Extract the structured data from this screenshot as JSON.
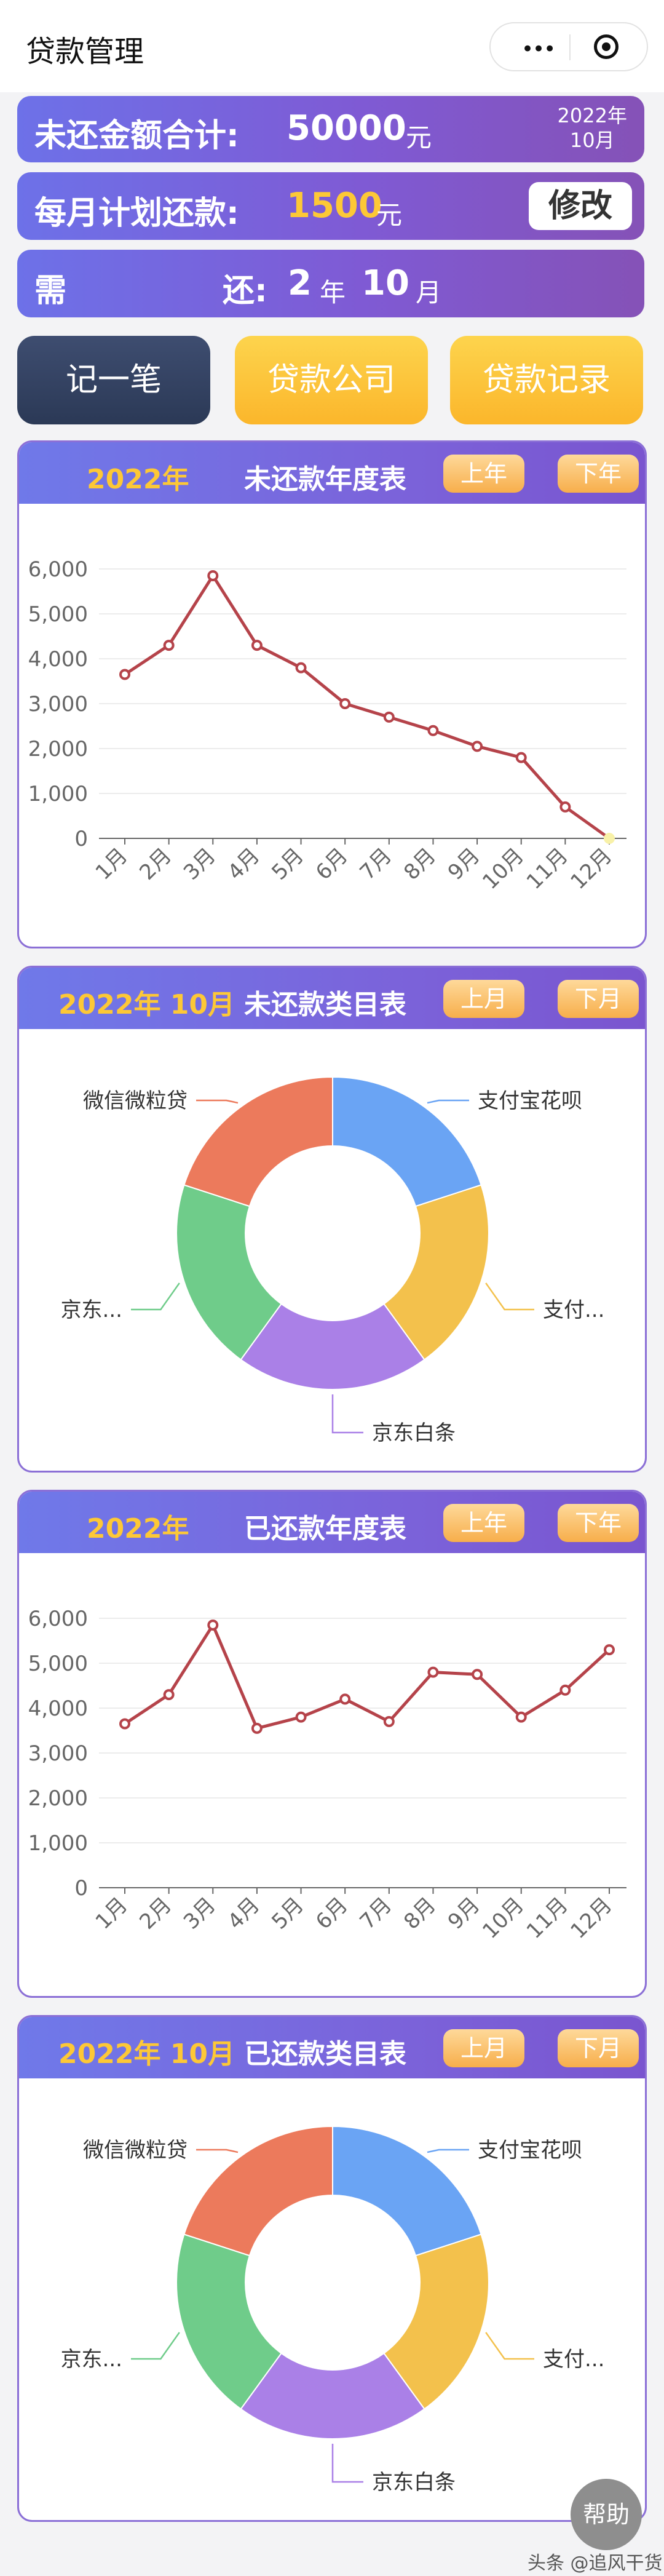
{
  "app": {
    "title": "贷款管理"
  },
  "capsule": {
    "more_glyph": "•••",
    "close_icon": "target-icon"
  },
  "summary": {
    "outstanding_label": "未还金额合计:",
    "outstanding_value": "50000",
    "outstanding_unit": "元",
    "date_year": "2022年",
    "date_month": "10月",
    "monthly_label": "每月计划还款:",
    "monthly_value": "1500",
    "monthly_unit": "元",
    "edit_label": "修改",
    "need_label": "需",
    "repay_label": "还:",
    "years_value": "2",
    "years_unit": "年",
    "months_value": "10",
    "months_unit": "月"
  },
  "actions": {
    "record": "记一笔",
    "companies": "贷款公司",
    "history": "贷款记录"
  },
  "colors": {
    "accent_yellow": "#fdc836",
    "line_series": "#b5434a",
    "pie": [
      "#6aa4f4",
      "#f3c14c",
      "#aa80e7",
      "#6fcc8a",
      "#ec7a5c"
    ]
  },
  "cards": [
    {
      "period": "2022年",
      "title": "未还款年度表",
      "prev": "上年",
      "next": "下年"
    },
    {
      "period": "2022年 10月",
      "title": "未还款类目表",
      "prev": "上月",
      "next": "下月"
    },
    {
      "period": "2022年",
      "title": "已还款年度表",
      "prev": "上年",
      "next": "下年"
    },
    {
      "period": "2022年 10月",
      "title": "已还款类目表",
      "prev": "上月",
      "next": "下月"
    }
  ],
  "chart_data": [
    {
      "type": "line",
      "categories": [
        "1月",
        "2月",
        "3月",
        "4月",
        "5月",
        "6月",
        "7月",
        "8月",
        "9月",
        "10月",
        "11月",
        "12月"
      ],
      "series": [
        {
          "values": [
            3650,
            4300,
            5850,
            4300,
            3800,
            3000,
            2700,
            2400,
            2050,
            1800,
            700,
            0
          ]
        }
      ],
      "yticks": [
        "0",
        "1,000",
        "2,000",
        "3,000",
        "4,000",
        "5,000",
        "6,000"
      ],
      "ylim": [
        0,
        6000
      ],
      "grid": true
    },
    {
      "type": "pie",
      "labels": [
        "支付宝花呗",
        "支付...",
        "京东白条",
        "京东...",
        "微信微粒贷"
      ],
      "values": [
        20,
        20,
        20,
        20,
        20
      ]
    },
    {
      "type": "line",
      "categories": [
        "1月",
        "2月",
        "3月",
        "4月",
        "5月",
        "6月",
        "7月",
        "8月",
        "9月",
        "10月",
        "11月",
        "12月"
      ],
      "series": [
        {
          "values": [
            3650,
            4300,
            5850,
            3550,
            3800,
            4200,
            3700,
            4800,
            4750,
            3800,
            4400,
            5300
          ]
        }
      ],
      "yticks": [
        "0",
        "1,000",
        "2,000",
        "3,000",
        "4,000",
        "5,000",
        "6,000"
      ],
      "ylim": [
        0,
        6000
      ],
      "grid": true
    },
    {
      "type": "pie",
      "labels": [
        "支付宝花呗",
        "支付...",
        "京东白条",
        "京东...",
        "微信微粒贷"
      ],
      "values": [
        20,
        20,
        20,
        20,
        20
      ]
    }
  ],
  "help": {
    "label": "帮助"
  },
  "watermark": "头条 @追风干货"
}
